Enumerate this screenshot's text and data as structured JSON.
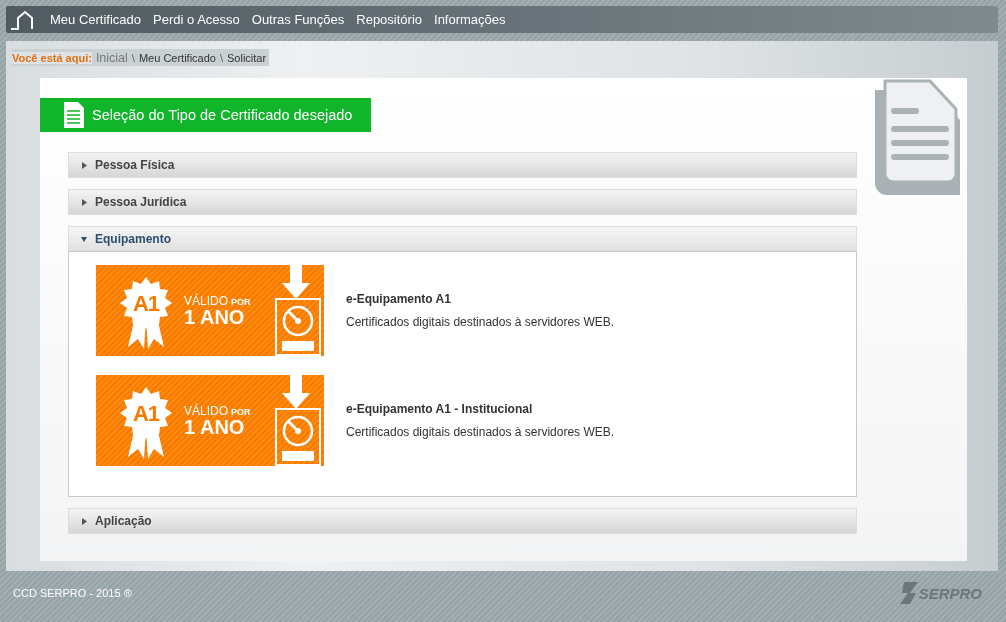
{
  "nav": {
    "items": [
      "Meu Certificado",
      "Perdi o Acesso",
      "Outras Funções",
      "Repositório",
      "Informações"
    ]
  },
  "breadcrumb": {
    "label": "Você está aqui:",
    "items": [
      "Inicial",
      "Meu Certificado",
      "Solicitar"
    ],
    "separator": "\\"
  },
  "panel": {
    "title": "Seleção do Tipo de Certificado desejado"
  },
  "sections": [
    {
      "title": "Pessoa Física",
      "expanded": false
    },
    {
      "title": "Pessoa Jurídica",
      "expanded": false
    },
    {
      "title": "Equipamento",
      "expanded": true,
      "products": [
        {
          "badge": "A1",
          "valid_label": "VÁLIDO",
          "valid_for": "POR",
          "duration": "1 ANO",
          "name": "e-Equipamento A1",
          "description": "Certificados digitais destinados à servidores WEB."
        },
        {
          "badge": "A1",
          "valid_label": "VÁLIDO",
          "valid_for": "POR",
          "duration": "1 ANO",
          "name": "e-Equipamento A1 - Institucional",
          "description": "Certificados digitais destinados à servidores WEB."
        }
      ]
    },
    {
      "title": "Aplicação",
      "expanded": false
    }
  ],
  "footer": {
    "copyright": "CCD SERPRO - 2015 ®",
    "logo": "SERPRO"
  }
}
